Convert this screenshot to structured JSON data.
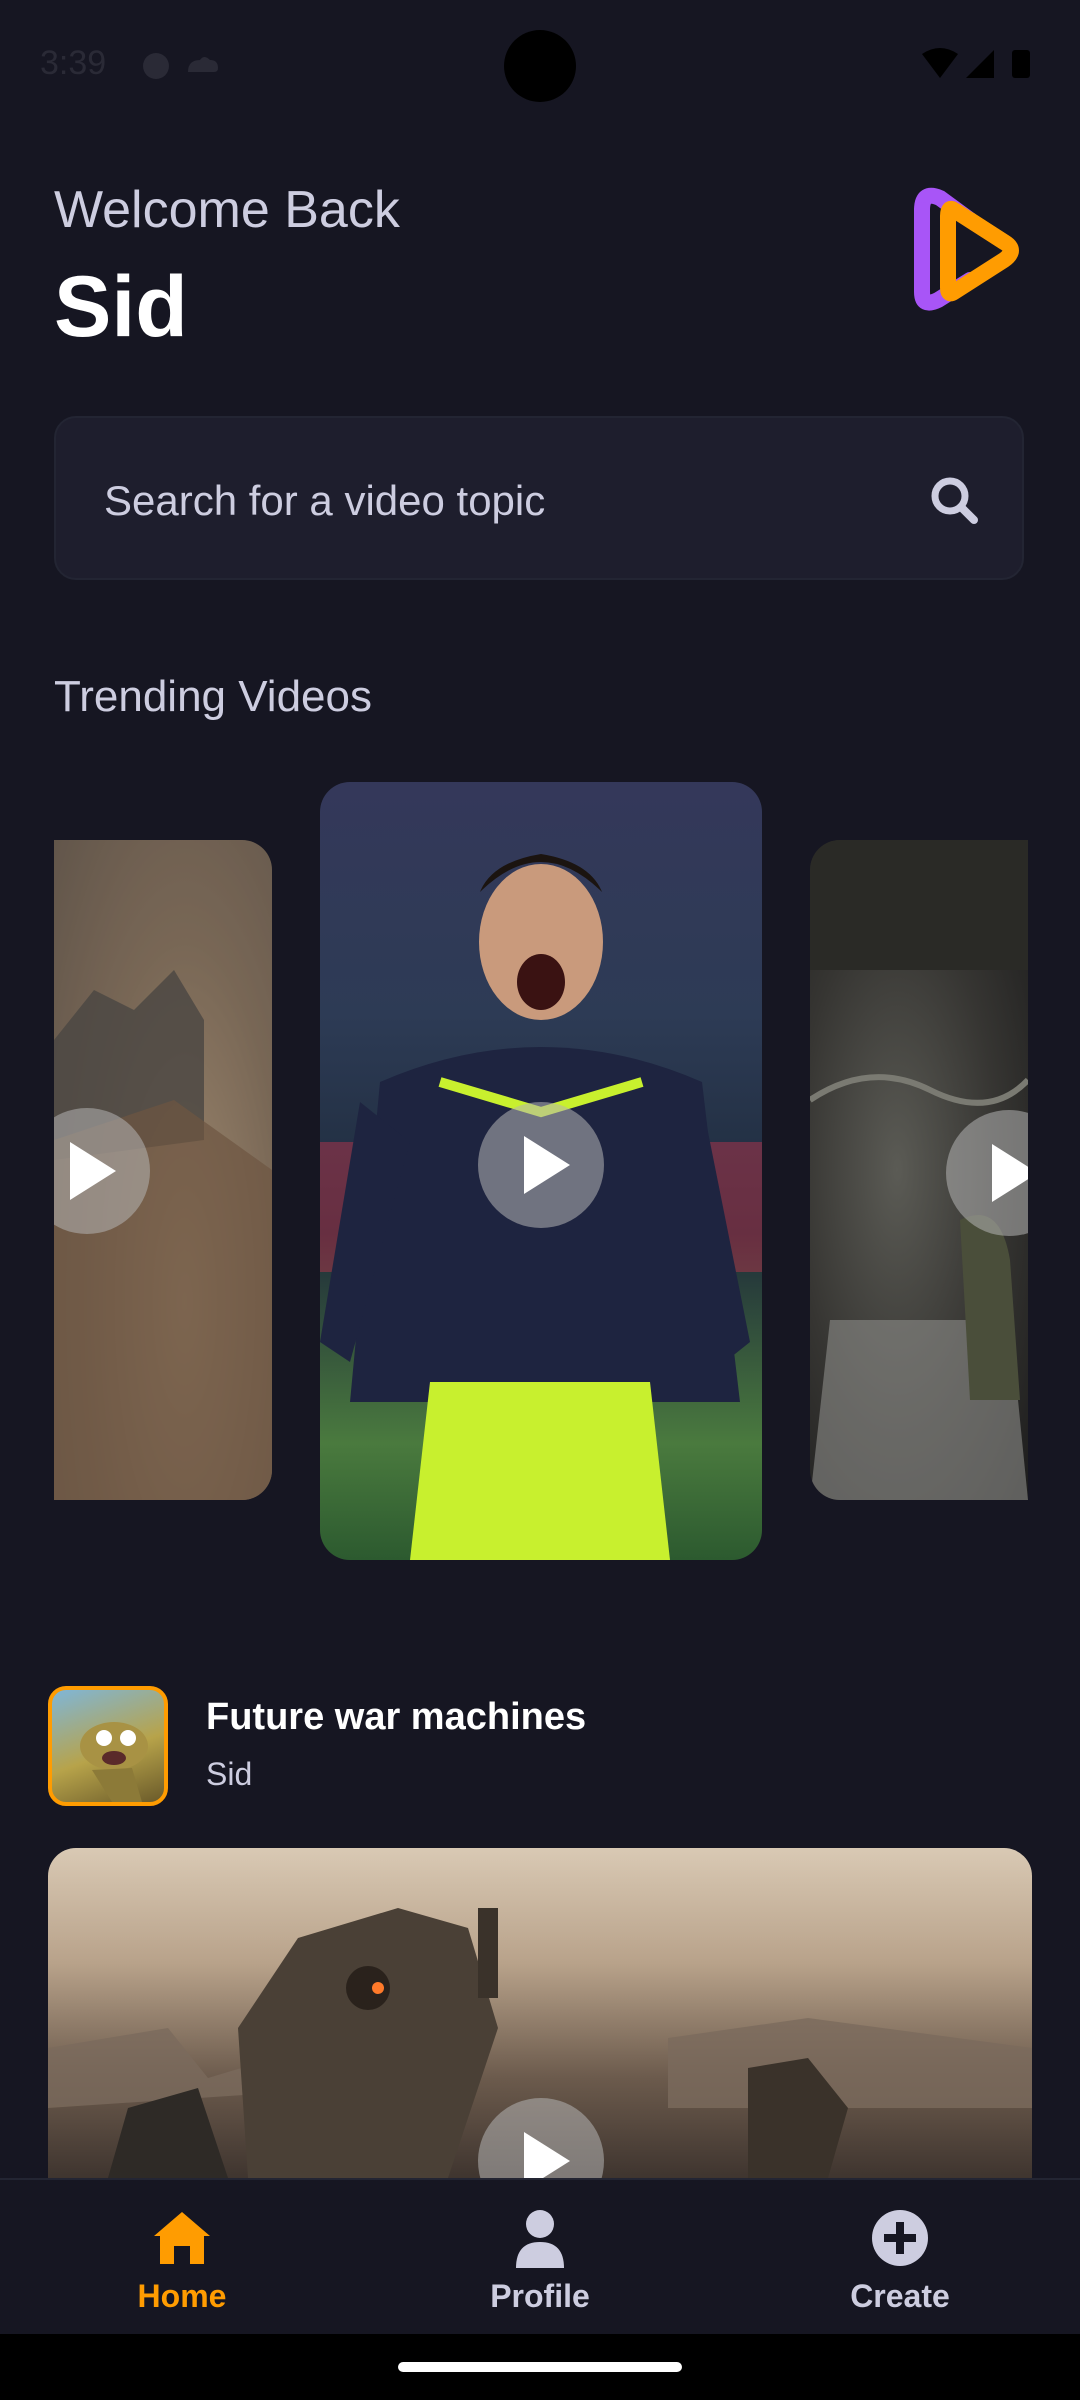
{
  "status_bar": {
    "time": "3:39"
  },
  "header": {
    "greeting": "Welcome Back",
    "username": "Sid"
  },
  "search": {
    "placeholder": "Search for a video topic"
  },
  "trending": {
    "title": "Trending Videos"
  },
  "post": {
    "title": "Future war machines",
    "author": "Sid"
  },
  "tabs": [
    {
      "label": "Home",
      "icon": "home-icon",
      "active": true
    },
    {
      "label": "Profile",
      "icon": "profile-icon",
      "active": false
    },
    {
      "label": "Create",
      "icon": "plus-circle-icon",
      "active": false
    }
  ],
  "colors": {
    "background": "#161622",
    "accent": "#FF9C01",
    "logo_purple": "#A855F7",
    "text_muted": "#CDCDE0"
  }
}
